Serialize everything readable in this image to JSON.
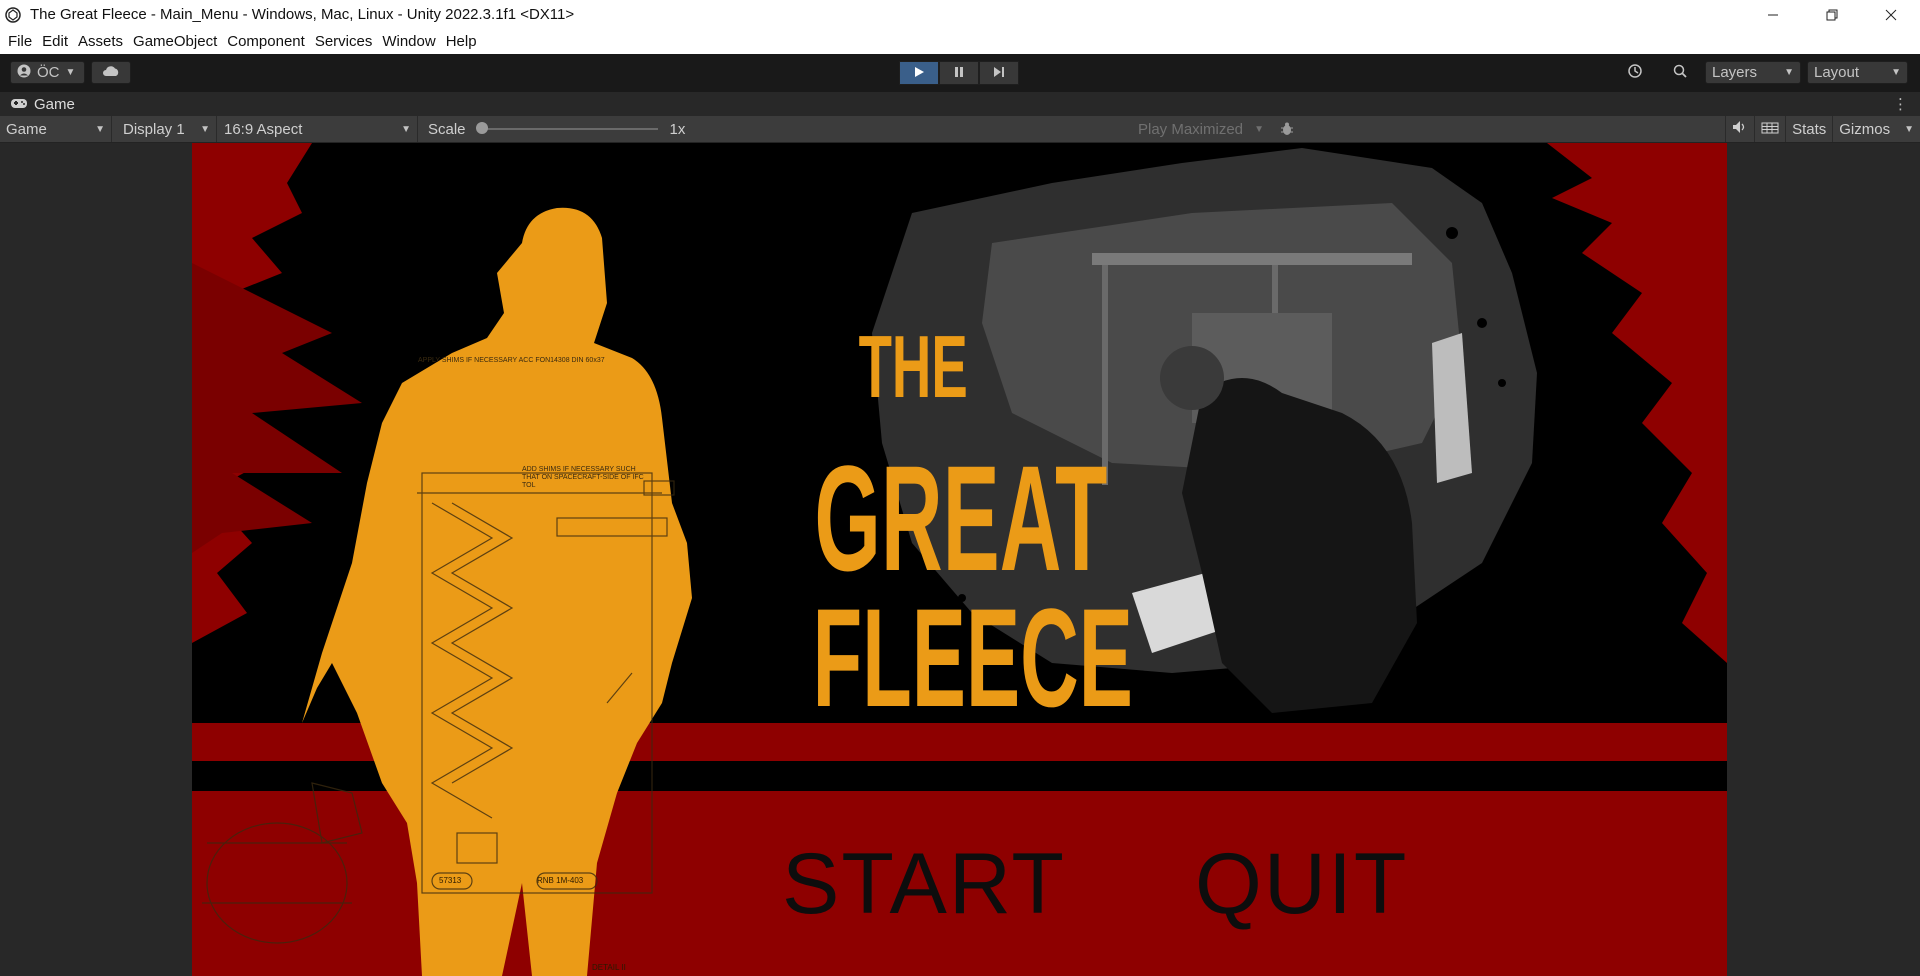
{
  "window": {
    "title": "The Great Fleece - Main_Menu - Windows, Mac, Linux - Unity 2022.3.1f1 <DX11>"
  },
  "menu": [
    "File",
    "Edit",
    "Assets",
    "GameObject",
    "Component",
    "Services",
    "Window",
    "Help"
  ],
  "toolbar": {
    "account_label": "ÖC",
    "layers_label": "Layers",
    "layout_label": "Layout"
  },
  "panel": {
    "tab_label": "Game"
  },
  "gamebar": {
    "view_select": "Game",
    "display_select": "Display 1",
    "aspect_select": "16:9 Aspect",
    "scale_label": "Scale",
    "scale_value": "1x",
    "play_maximized": "Play Maximized",
    "stats_label": "Stats",
    "gizmos_label": "Gizmos"
  },
  "game": {
    "logo_line1": "THE",
    "logo_line2": "GREAT",
    "logo_line3": "FLEECE",
    "start_label": "START",
    "quit_label": "QUIT",
    "blueprint_text_1": "APPLY SHIMS IF NECESSARY ACC FON14308 DIN 60x37",
    "blueprint_text_2": "ADD SHIMS IF NECESSARY SUCH THAT ON SPACECRAFT-SIDE OF IFC TOL",
    "blueprint_tag_1": "57313",
    "blueprint_tag_2": "RNB 1M-403",
    "blueprint_detail": "DETAIL II",
    "colors": {
      "orange": "#eb9b17",
      "red": "#8e0000",
      "black": "#000000"
    }
  }
}
